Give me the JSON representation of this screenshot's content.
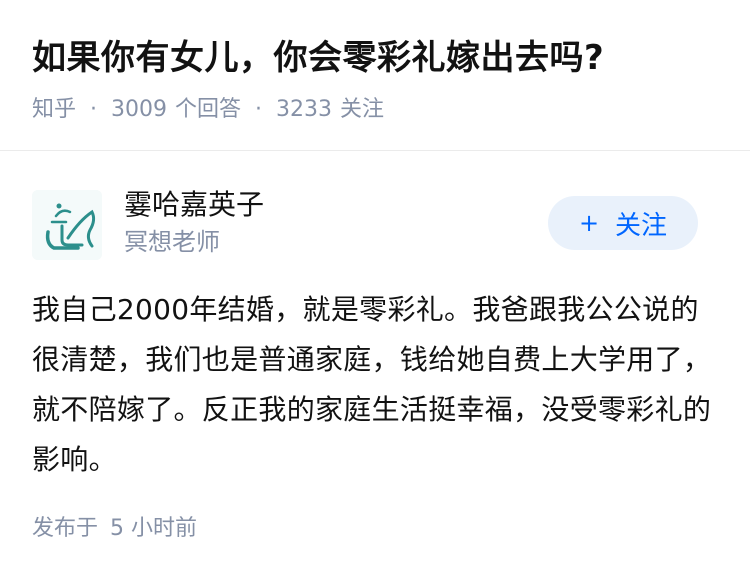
{
  "question": {
    "title": "如果你有女儿，你会零彩礼嫁出去吗?",
    "source": "知乎",
    "separator": "·",
    "answer_count": "3009",
    "answer_label": "个回答",
    "follower_count": "3233",
    "follower_label": "关注"
  },
  "answer": {
    "author": {
      "name": "霎哈嘉英子",
      "bio": "冥想老师",
      "avatar_icon": "abstract-chair-logo-icon"
    },
    "follow_button": {
      "icon": "plus-icon",
      "plus": "+",
      "label": "关注"
    },
    "content": "我自己2000年结婚，就是零彩礼。我爸跟我公公说的很清楚，我们也是普通家庭，钱给她自费上大学用了，就不陪嫁了。反正我的家庭生活挺幸福，没受零彩礼的影响。",
    "footer": {
      "label": "发布于",
      "time": "5 小时前"
    }
  },
  "colors": {
    "title": "#121212",
    "meta": "#8590a6",
    "accent": "#0066ff",
    "button_bg": "#e9f1fb",
    "avatar_teal": "#2c8f8c"
  }
}
